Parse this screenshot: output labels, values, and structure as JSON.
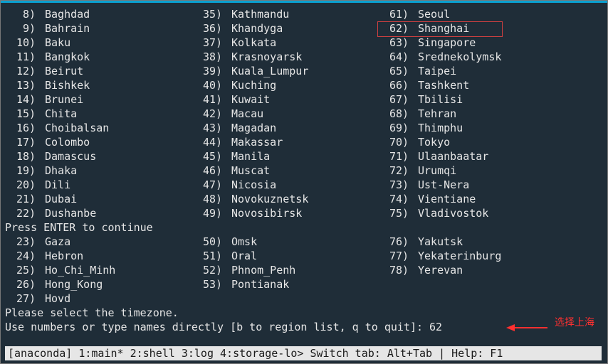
{
  "columns": [
    [
      {
        "n": 8,
        "name": "Baghdad"
      },
      {
        "n": 9,
        "name": "Bahrain"
      },
      {
        "n": 10,
        "name": "Baku"
      },
      {
        "n": 11,
        "name": "Bangkok"
      },
      {
        "n": 12,
        "name": "Beirut"
      },
      {
        "n": 13,
        "name": "Bishkek"
      },
      {
        "n": 14,
        "name": "Brunei"
      },
      {
        "n": 15,
        "name": "Chita"
      },
      {
        "n": 16,
        "name": "Choibalsan"
      },
      {
        "n": 17,
        "name": "Colombo"
      },
      {
        "n": 18,
        "name": "Damascus"
      },
      {
        "n": 19,
        "name": "Dhaka"
      },
      {
        "n": 20,
        "name": "Dili"
      },
      {
        "n": 21,
        "name": "Dubai"
      },
      {
        "n": 22,
        "name": "Dushanbe"
      }
    ],
    [
      {
        "n": 35,
        "name": "Kathmandu"
      },
      {
        "n": 36,
        "name": "Khandyga"
      },
      {
        "n": 37,
        "name": "Kolkata"
      },
      {
        "n": 38,
        "name": "Krasnoyarsk"
      },
      {
        "n": 39,
        "name": "Kuala_Lumpur"
      },
      {
        "n": 40,
        "name": "Kuching"
      },
      {
        "n": 41,
        "name": "Kuwait"
      },
      {
        "n": 42,
        "name": "Macau"
      },
      {
        "n": 43,
        "name": "Magadan"
      },
      {
        "n": 44,
        "name": "Makassar"
      },
      {
        "n": 45,
        "name": "Manila"
      },
      {
        "n": 46,
        "name": "Muscat"
      },
      {
        "n": 47,
        "name": "Nicosia"
      },
      {
        "n": 48,
        "name": "Novokuznetsk"
      },
      {
        "n": 49,
        "name": "Novosibirsk"
      }
    ],
    [
      {
        "n": 61,
        "name": "Seoul"
      },
      {
        "n": 62,
        "name": "Shanghai",
        "boxed": true
      },
      {
        "n": 63,
        "name": "Singapore"
      },
      {
        "n": 64,
        "name": "Srednekolymsk"
      },
      {
        "n": 65,
        "name": "Taipei"
      },
      {
        "n": 66,
        "name": "Tashkent"
      },
      {
        "n": 67,
        "name": "Tbilisi"
      },
      {
        "n": 68,
        "name": "Tehran"
      },
      {
        "n": 69,
        "name": "Thimphu"
      },
      {
        "n": 70,
        "name": "Tokyo"
      },
      {
        "n": 71,
        "name": "Ulaanbaatar"
      },
      {
        "n": 72,
        "name": "Urumqi"
      },
      {
        "n": 73,
        "name": "Ust-Nera"
      },
      {
        "n": 74,
        "name": "Vientiane"
      },
      {
        "n": 75,
        "name": "Vladivostok"
      }
    ]
  ],
  "press_enter": "Press ENTER to continue",
  "columns2": [
    [
      {
        "n": 23,
        "name": "Gaza"
      },
      {
        "n": 24,
        "name": "Hebron"
      },
      {
        "n": 25,
        "name": "Ho_Chi_Minh"
      },
      {
        "n": 26,
        "name": "Hong_Kong"
      },
      {
        "n": 27,
        "name": "Hovd"
      }
    ],
    [
      {
        "n": 50,
        "name": "Omsk"
      },
      {
        "n": 51,
        "name": "Oral"
      },
      {
        "n": 52,
        "name": "Phnom_Penh"
      },
      {
        "n": 53,
        "name": "Pontianak"
      }
    ],
    [
      {
        "n": 76,
        "name": "Yakutsk"
      },
      {
        "n": 77,
        "name": "Yekaterinburg"
      },
      {
        "n": 78,
        "name": "Yerevan"
      }
    ]
  ],
  "prompt1": "Please select the timezone.",
  "prompt2_prefix": "Use numbers or type names directly [b to region list, q to quit]: ",
  "prompt2_value": "62",
  "annotation": "选择上海",
  "statusbar": "[anaconda] 1:main* 2:shell  3:log  4:storage-lo> Switch tab: Alt+Tab | Help: F1"
}
